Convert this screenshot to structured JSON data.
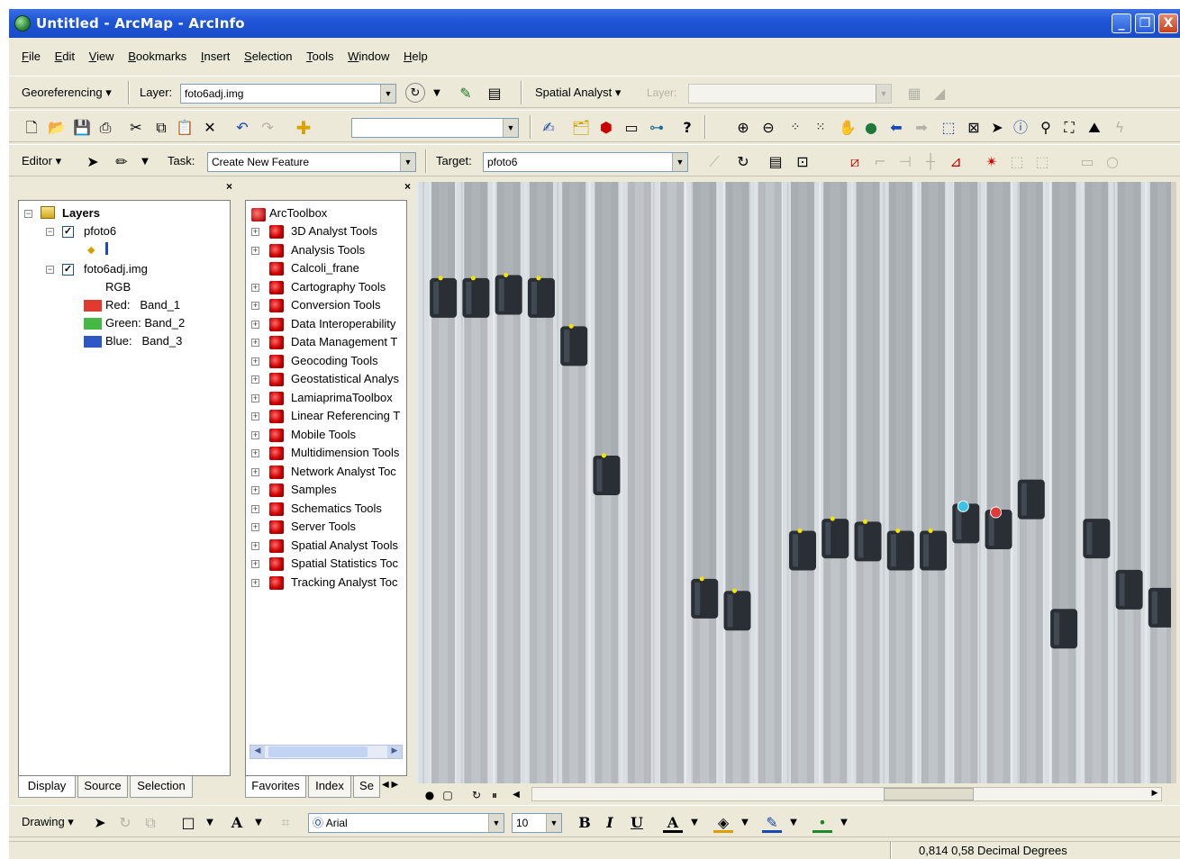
{
  "window": {
    "title": "Untitled - ArcMap - ArcInfo",
    "min": "_",
    "max": "❐",
    "close": "X"
  },
  "menu": [
    "File",
    "Edit",
    "View",
    "Bookmarks",
    "Insert",
    "Selection",
    "Tools",
    "Window",
    "Help"
  ],
  "georef_toolbar": {
    "label": "Georeferencing",
    "layer_label": "Layer:",
    "layer_value": "foto6adj.img",
    "spatial_analyst_label": "Spatial Analyst",
    "sa_layer_label": "Layer:",
    "sa_layer_value": ""
  },
  "editor_toolbar": {
    "label": "Editor",
    "task_label": "Task:",
    "task_value": "Create New Feature",
    "target_label": "Target:",
    "target_value": "pfoto6"
  },
  "toc": {
    "root": "Layers",
    "layers": [
      {
        "name": "pfoto6",
        "checked": true
      },
      {
        "name": "foto6adj.img",
        "checked": true,
        "render": "RGB",
        "bands": [
          {
            "label": "Red:",
            "band": "Band_1",
            "color": "#e23a2e"
          },
          {
            "label": "Green:",
            "band": "Band_2",
            "color": "#45b845"
          },
          {
            "label": "Blue:",
            "band": "Band_3",
            "color": "#2f56c7"
          }
        ]
      }
    ],
    "tabs": [
      "Display",
      "Source",
      "Selection"
    ]
  },
  "toolbox": {
    "root": "ArcToolbox",
    "items": [
      "3D Analyst Tools",
      "Analysis Tools",
      "Calcoli_frane",
      "Cartography Tools",
      "Conversion Tools",
      "Data Interoperability",
      "Data Management T",
      "Geocoding Tools",
      "Geostatistical Analys",
      "LamiaprimaToolbox",
      "Linear Referencing T",
      "Mobile Tools",
      "Multidimension Tools",
      "Network Analyst Toc",
      "Samples",
      "Schematics Tools",
      "Server Tools",
      "Spatial Analyst Tools",
      "Spatial Statistics Toc",
      "Tracking Analyst Toc"
    ],
    "tabs": [
      "Favorites",
      "Index",
      "Se"
    ]
  },
  "drawing_toolbar": {
    "label": "Drawing",
    "font": "Arial",
    "size": "10",
    "bold": "B",
    "italic": "I",
    "underline": "U"
  },
  "status": {
    "coords": "0,814  0,58 Decimal Degrees"
  },
  "map": {
    "strips": [
      {
        "y": 0.16,
        "marker": "yellow"
      },
      {
        "y": 0.16,
        "marker": "yellow"
      },
      {
        "y": 0.155,
        "marker": "yellow"
      },
      {
        "y": 0.16,
        "marker": "yellow"
      },
      {
        "y": 0.24,
        "marker": "yellow"
      },
      {
        "y": 0.455,
        "marker": "yellow"
      },
      {
        "y": 0.0,
        "marker": "none"
      },
      {
        "y": 0.0,
        "marker": "none"
      },
      {
        "y": 0.66,
        "marker": "yellow"
      },
      {
        "y": 0.68,
        "marker": "yellow"
      },
      {
        "y": 0.0,
        "marker": "none"
      },
      {
        "y": 0.58,
        "marker": "yellow"
      },
      {
        "y": 0.56,
        "marker": "yellow"
      },
      {
        "y": 0.565,
        "marker": "yellow"
      },
      {
        "y": 0.58,
        "marker": "yellow"
      },
      {
        "y": 0.58,
        "marker": "yellow"
      },
      {
        "y": 0.535,
        "marker": "cyan"
      },
      {
        "y": 0.545,
        "marker": "red"
      },
      {
        "y": 0.495,
        "marker": "none"
      },
      {
        "y": 0.71,
        "marker": "none"
      },
      {
        "y": 0.56,
        "marker": "none"
      },
      {
        "y": 0.645,
        "marker": "none"
      },
      {
        "y": 0.675,
        "marker": "none"
      }
    ]
  }
}
